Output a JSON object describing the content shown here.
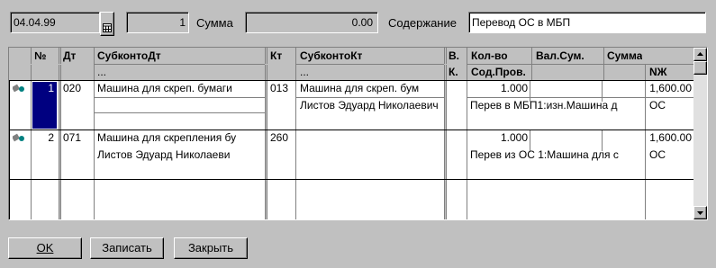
{
  "header": {
    "date": "04.04.99",
    "number": "1",
    "sum_label": "Сумма",
    "sum_value": "0.00",
    "content_label": "Содержание",
    "content_value": "Перевод ОС в МБП"
  },
  "columns": {
    "num": "№",
    "dt": "Дт",
    "subconto_dt": "СубконтоДт",
    "subconto_dt_sub": "...",
    "kt": "Кт",
    "subconto_kt": "СубконтоКт",
    "subconto_kt_sub": "...",
    "v": "В.",
    "k": "К.",
    "qty": "Кол-во",
    "val_sum": "Вал.Сум.",
    "sum": "Сумма",
    "sod_prov": "Сод.Пров.",
    "nzh": "NЖ"
  },
  "rows": [
    {
      "num": "1",
      "dt": "020",
      "subconto_dt_1": "Машина для скреп. бумаги",
      "subconto_dt_2": "",
      "kt": "013",
      "subconto_kt_1": "Машина для скреп. бум",
      "subconto_kt_2": "Листов Эдуард Николаевич",
      "qty": "1.000",
      "sum": "1,600.00",
      "sod_prov": "Перев в МБП1:изн.Машина д",
      "nzh": "ОС"
    },
    {
      "num": "2",
      "dt": "071",
      "subconto_dt_1": "Машина для скрепления бу",
      "subconto_dt_2": "Листов Эдуард Николаеви",
      "kt": "260",
      "subconto_kt_1": "",
      "subconto_kt_2": "",
      "qty": "1.000",
      "sum": "1,600.00",
      "sod_prov": "Перев из ОС 1:Машина для с",
      "nzh": "ОС"
    }
  ],
  "buttons": {
    "ok": "OK",
    "save": "Записать",
    "close": "Закрыть"
  },
  "colors": {
    "window_bg": "#c0c0c0",
    "selection": "#000080"
  }
}
